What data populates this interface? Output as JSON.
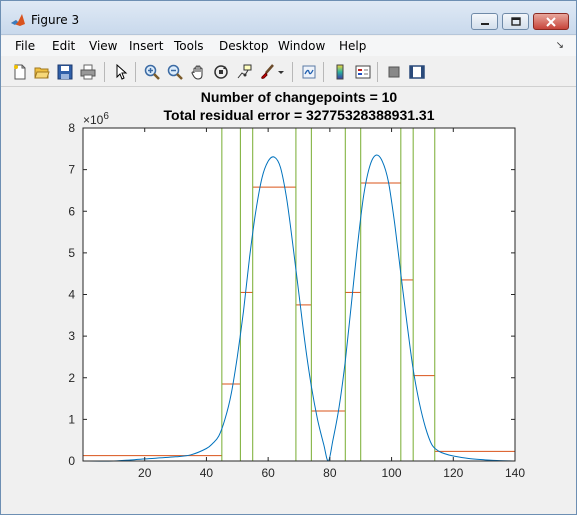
{
  "window": {
    "title": "Figure 3"
  },
  "menu": {
    "items": [
      "File",
      "Edit",
      "View",
      "Insert",
      "Tools",
      "Desktop",
      "Window",
      "Help"
    ]
  },
  "toolbar": {
    "icons": [
      "new-figure-icon",
      "open-file-icon",
      "save-icon",
      "print-icon",
      "pointer-icon",
      "zoom-in-icon",
      "zoom-out-icon",
      "pan-icon",
      "rotate-3d-icon",
      "data-cursor-icon",
      "brush-icon",
      "link-plot-icon",
      "colorbar-icon",
      "legend-icon",
      "hide-plot-tools-icon",
      "show-plot-tools-icon"
    ]
  },
  "chart_data": {
    "type": "line",
    "title": [
      "Number of changepoints = 10",
      "Total residual error = 32775328388931.31"
    ],
    "xlim": [
      0,
      140
    ],
    "ylim": [
      0,
      8000000
    ],
    "y_exponent_label": "×10",
    "y_exponent_power": "6",
    "xticks": [
      20,
      40,
      60,
      80,
      100,
      120,
      140
    ],
    "xtick_labels": [
      "20",
      "40",
      "60",
      "80",
      "100",
      "120",
      "140"
    ],
    "yticks": [
      0,
      1000000,
      2000000,
      3000000,
      4000000,
      5000000,
      6000000,
      7000000,
      8000000
    ],
    "ytick_labels": [
      "0",
      "1",
      "2",
      "3",
      "4",
      "5",
      "6",
      "7",
      "8"
    ],
    "signal": {
      "x": [
        0,
        10,
        20,
        30,
        35,
        40,
        42,
        44,
        46,
        48,
        50,
        52,
        54,
        56,
        58,
        60,
        62,
        64,
        66,
        68,
        70,
        72,
        74,
        76,
        78,
        79.5,
        81,
        83,
        85,
        87,
        89,
        91,
        93,
        95,
        97,
        99,
        101,
        103,
        105,
        107,
        109,
        111,
        113,
        115,
        117,
        120,
        125,
        130,
        135,
        140
      ],
      "y": [
        0,
        0,
        50000,
        100000,
        150000,
        300000,
        420000,
        600000,
        1000000,
        1600000,
        2500000,
        3600000,
        4900000,
        6000000,
        6800000,
        7200000,
        7300000,
        7050000,
        6300000,
        5200000,
        4000000,
        2800000,
        1800000,
        1000000,
        400000,
        0,
        500000,
        1300000,
        2400000,
        3800000,
        5200000,
        6400000,
        7100000,
        7350000,
        7200000,
        6700000,
        5700000,
        4500000,
        3300000,
        2200000,
        1400000,
        800000,
        400000,
        250000,
        180000,
        120000,
        60000,
        30000,
        10000,
        0
      ],
      "color": "#0072bd"
    },
    "changepoints": [
      45,
      51,
      55,
      69,
      74,
      85,
      90,
      103,
      107,
      114
    ],
    "changepoint_color": "#77ac30",
    "segment_means": [
      {
        "x0": 0,
        "x1": 45,
        "y": 130000
      },
      {
        "x0": 45,
        "x1": 51,
        "y": 1850000
      },
      {
        "x0": 51,
        "x1": 55,
        "y": 4050000
      },
      {
        "x0": 55,
        "x1": 69,
        "y": 6580000
      },
      {
        "x0": 69,
        "x1": 74,
        "y": 3750000
      },
      {
        "x0": 74,
        "x1": 85,
        "y": 1200000
      },
      {
        "x0": 85,
        "x1": 90,
        "y": 4050000
      },
      {
        "x0": 90,
        "x1": 103,
        "y": 6680000
      },
      {
        "x0": 103,
        "x1": 107,
        "y": 4350000
      },
      {
        "x0": 107,
        "x1": 114,
        "y": 2050000
      },
      {
        "x0": 114,
        "x1": 140,
        "y": 230000
      }
    ],
    "segment_color": "#d95319",
    "grid": false
  }
}
